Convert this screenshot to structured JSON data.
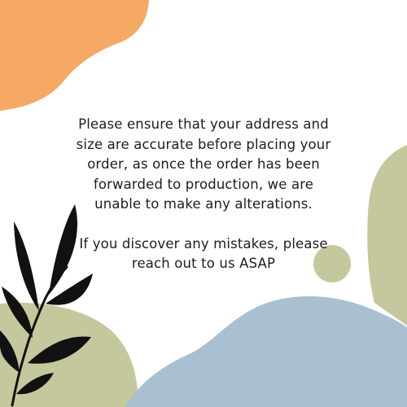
{
  "colors": {
    "background": "#ffffff",
    "orange_blob": "#f6a964",
    "sage_green": "#c4c89c",
    "dusty_blue": "#a9c0d1",
    "leaf_black": "#111111",
    "text": "#1d1d1d"
  },
  "notice": {
    "paragraph_1_lines": [
      "Please ensure that your address and",
      "size are accurate before placing your",
      "order, as once the order has been",
      "forwarded to production, we are",
      "unable to make any alterations."
    ],
    "paragraph_2_lines": [
      "If you discover any mistakes, please",
      "reach out to us ASAP"
    ]
  }
}
